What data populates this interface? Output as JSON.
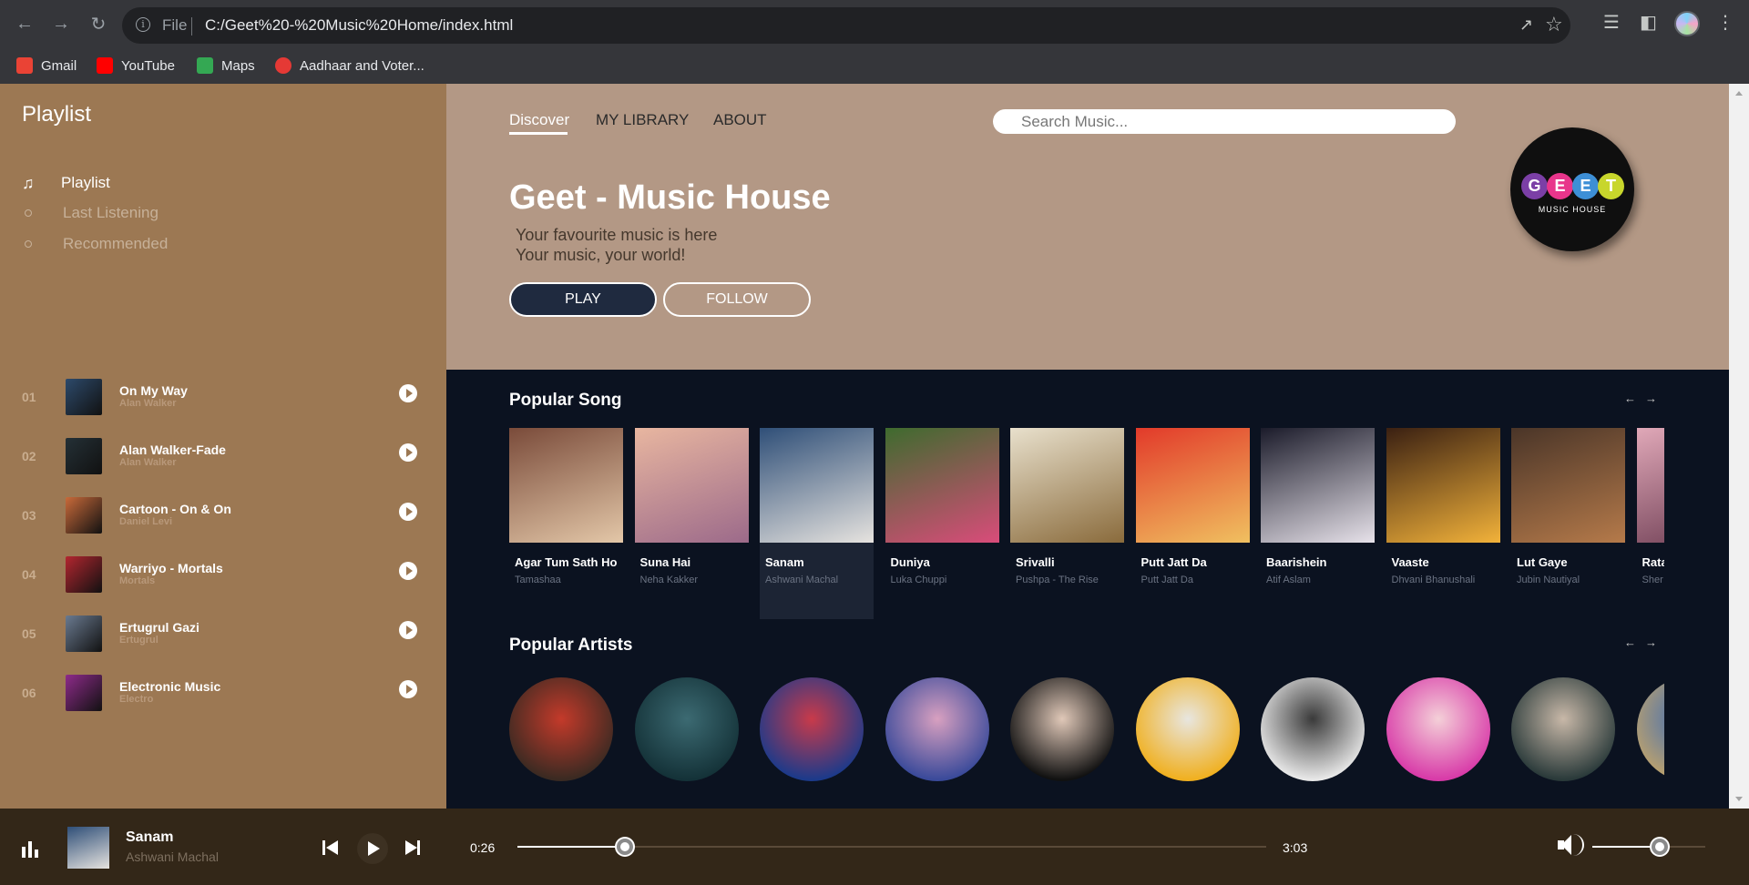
{
  "browser": {
    "scheme": "File",
    "url": "C:/Geet%20-%20Music%20Home/index.html",
    "bookmarks": [
      {
        "label": "Gmail",
        "color": "#ea4335"
      },
      {
        "label": "YouTube",
        "color": "#ff0000"
      },
      {
        "label": "Maps",
        "color": "#34a853"
      },
      {
        "label": "Aadhaar and Voter...",
        "color": "#e53935"
      }
    ]
  },
  "sidebar": {
    "title": "Playlist",
    "menu": [
      {
        "label": "Playlist",
        "icon": "music-note-icon",
        "active": true
      },
      {
        "label": "Last Listening",
        "icon": "dot-icon",
        "active": false
      },
      {
        "label": "Recommended",
        "icon": "dot-icon",
        "active": false
      }
    ],
    "tracks": [
      {
        "num": "01",
        "name": "On My Way",
        "artist": "Alan Walker",
        "art": "#2d4a6b"
      },
      {
        "num": "02",
        "name": "Alan Walker-Fade",
        "artist": "Alan Walker",
        "art": "#243036"
      },
      {
        "num": "03",
        "name": "Cartoon - On & On",
        "artist": "Daniel Levi",
        "art": "#c96a3a"
      },
      {
        "num": "04",
        "name": "Warriyo - Mortals",
        "artist": "Mortals",
        "art": "#b3262f"
      },
      {
        "num": "05",
        "name": "Ertugrul Gazi",
        "artist": "Ertugrul",
        "art": "#6a7a90"
      },
      {
        "num": "06",
        "name": "Electronic Music",
        "artist": "Electro",
        "art": "#8e2b8a"
      }
    ]
  },
  "hero": {
    "tabs": [
      {
        "label": "Discover",
        "active": true
      },
      {
        "label": "MY LIBRARY",
        "active": false
      },
      {
        "label": "ABOUT",
        "active": false
      }
    ],
    "search_placeholder": "Search Music...",
    "title": "Geet - Music House",
    "tagline1": "Your favourite music is here",
    "tagline2": "Your music, your world!",
    "play_label": "PLAY",
    "follow_label": "FOLLOW",
    "logo": {
      "letters": [
        {
          "char": "G",
          "color": "#7b3fa6"
        },
        {
          "char": "E",
          "color": "#e8358b"
        },
        {
          "char": "E",
          "color": "#3d8fd6"
        },
        {
          "char": "T",
          "color": "#c8d62c"
        }
      ],
      "subtitle": "MUSIC HOUSE"
    }
  },
  "popular_songs": {
    "title": "Popular Song",
    "items": [
      {
        "name": "Agar Tum Sath Ho",
        "artist": "Tamashaa",
        "colors": [
          "#7a4b3a",
          "#e3c7a8"
        ],
        "active": false
      },
      {
        "name": "Suna Hai",
        "artist": "Neha Kakker",
        "colors": [
          "#e8b6a0",
          "#9c6a8a"
        ],
        "active": false
      },
      {
        "name": "Sanam",
        "artist": "Ashwani Machal",
        "colors": [
          "#2f4f78",
          "#e6e3df"
        ],
        "active": true
      },
      {
        "name": "Duniya",
        "artist": "Luka Chuppi",
        "colors": [
          "#3e6b2e",
          "#d94c7a"
        ],
        "active": false
      },
      {
        "name": "Srivalli",
        "artist": "Pushpa - The Rise",
        "colors": [
          "#e8e0cc",
          "#8a6b3c"
        ],
        "active": false
      },
      {
        "name": "Putt Jatt Da",
        "artist": "Putt Jatt Da",
        "colors": [
          "#e23a2a",
          "#f0c060"
        ],
        "active": false
      },
      {
        "name": "Baarishein",
        "artist": "Atif Aslam",
        "colors": [
          "#1b1b2a",
          "#e7e2ea"
        ],
        "active": false
      },
      {
        "name": "Vaaste",
        "artist": "Dhvani Bhanushali",
        "colors": [
          "#3a2012",
          "#f2b23a"
        ],
        "active": false
      },
      {
        "name": "Lut Gaye",
        "artist": "Jubin Nautiyal",
        "colors": [
          "#4a3528",
          "#b57a4a"
        ],
        "active": false
      },
      {
        "name": "Rata",
        "artist": "Sher",
        "colors": [
          "#e0a8b8",
          "#6a3a50"
        ],
        "active": false
      }
    ]
  },
  "popular_artists": {
    "title": "Popular Artists",
    "items": [
      {
        "colors": [
          "#3a2a22",
          "#c43a2a"
        ]
      },
      {
        "colors": [
          "#143238",
          "#3c6a72"
        ]
      },
      {
        "colors": [
          "#1c3a8a",
          "#c93a4a"
        ]
      },
      {
        "colors": [
          "#3a4a9a",
          "#d8a0c0"
        ]
      },
      {
        "colors": [
          "#111111",
          "#e0c8b8"
        ]
      },
      {
        "colors": [
          "#f0b020",
          "#e8e6e0"
        ]
      },
      {
        "colors": [
          "#e8e8e8",
          "#3a3a3a"
        ]
      },
      {
        "colors": [
          "#d83aa8",
          "#f4d0d8"
        ]
      },
      {
        "colors": [
          "#2a3a3a",
          "#c8b8a8"
        ]
      },
      {
        "colors": [
          "#b8a070",
          "#3a6ab8"
        ]
      }
    ]
  },
  "player": {
    "title": "Sanam",
    "artist": "Ashwani Machal",
    "current_time": "0:26",
    "total_time": "3:03",
    "progress": 0.143,
    "volume": 0.6
  }
}
